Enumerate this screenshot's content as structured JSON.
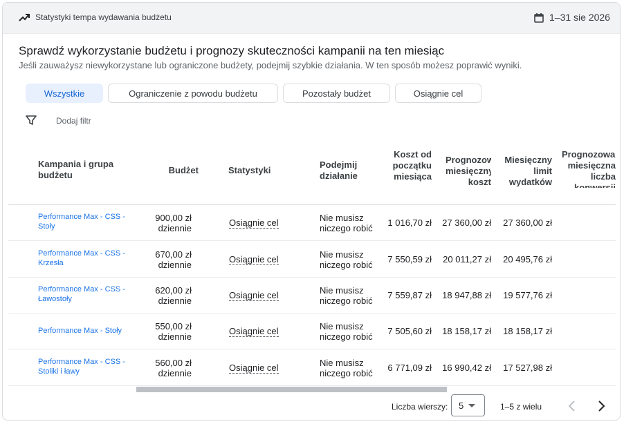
{
  "header": {
    "title": "Statystyki tempa wydawania budżetu",
    "date_range": "1–31 sie 2026",
    "trend_icon": "trending-icon",
    "calendar_icon": "calendar-icon"
  },
  "main": {
    "title": "Sprawdź wykorzystanie budżetu i prognozy skuteczności kampanii na ten miesiąc",
    "subtitle": "Jeśli zauważysz niewykorzystane lub ograniczone budżety, podejmij szybkie działania. W ten sposób możesz poprawić wyniki."
  },
  "chips": [
    {
      "label": "Wszystkie",
      "active": true
    },
    {
      "label": "Ograniczenie z powodu budżetu",
      "active": false
    },
    {
      "label": "Pozostały budżet",
      "active": false
    },
    {
      "label": "Osiągnie cel",
      "active": false
    }
  ],
  "filter": {
    "label": "Dodaj filtr",
    "icon": "filter-icon"
  },
  "table": {
    "headers": {
      "campaign": "Kampania i grupa budżetu",
      "budget": "Budżet",
      "stats": "Statystyki",
      "action": "Podejmij działanie",
      "cost": "Koszt od początku miesiąca",
      "forecast_cost": "Prognozowany miesięczny koszt",
      "limit": "Miesięczny limit wydatków",
      "forecast_conv": "Prognozowana miesięczna liczba konwersji"
    },
    "rows": [
      {
        "campaign": "Performance Max - CSS - Stoły",
        "budget": "900,00 zł dziennie",
        "stats": "Osiągnie cel",
        "action": "Nie musisz niczego robić",
        "cost": "1 016,70 zł",
        "forecast_cost": "27 360,00 zł",
        "limit": "27 360,00 zł"
      },
      {
        "campaign": "Performance Max - CSS - Krzesła",
        "budget": "670,00 zł dziennie",
        "stats": "Osiągnie cel",
        "action": "Nie musisz niczego robić",
        "cost": "7 550,59 zł",
        "forecast_cost": "20 011,27 zł",
        "limit": "20 495,76 zł"
      },
      {
        "campaign": "Performance Max - CSS - Ławostoły",
        "budget": "620,00 zł dziennie",
        "stats": "Osiągnie cel",
        "action": "Nie musisz niczego robić",
        "cost": "7 559,87 zł",
        "forecast_cost": "18 947,88 zł",
        "limit": "19 577,76 zł"
      },
      {
        "campaign": "Performance Max - Stoły",
        "budget": "550,00 zł dziennie",
        "stats": "Osiągnie cel",
        "action": "Nie musisz niczego robić",
        "cost": "7 505,60 zł",
        "forecast_cost": "18 158,17 zł",
        "limit": "18 158,17 zł"
      },
      {
        "campaign": "Performance Max - CSS - Stoliki i ławy",
        "budget": "560,00 zł dziennie",
        "stats": "Osiągnie cel",
        "action": "Nie musisz niczego robić",
        "cost": "6 771,09 zł",
        "forecast_cost": "16 990,42 zł",
        "limit": "17 527,98 zł"
      }
    ]
  },
  "footer": {
    "rows_label": "Liczba wierszy:",
    "rows_value": "5",
    "page_info": "1–5 z wielu",
    "prev_icon": "chevron-left-icon",
    "next_icon": "chevron-right-icon"
  }
}
